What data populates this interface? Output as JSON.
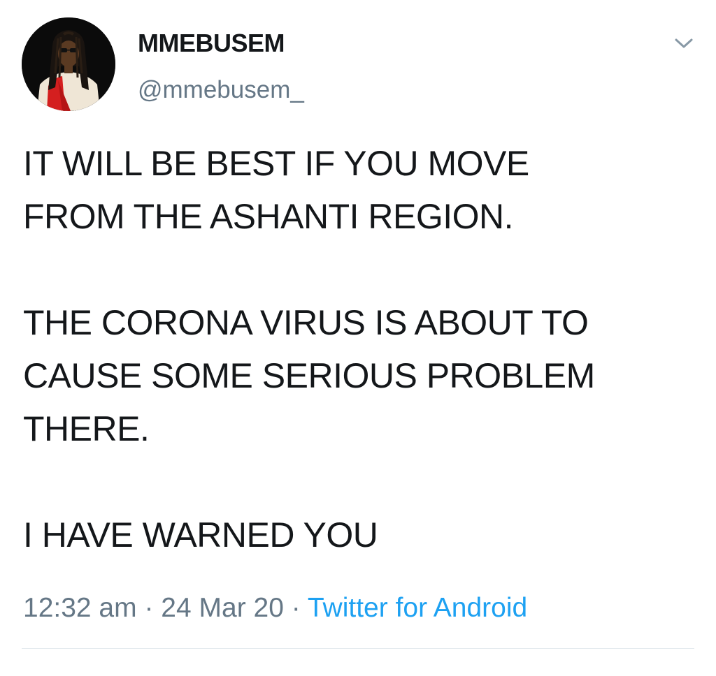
{
  "user": {
    "display_name": "MMEBUSEM",
    "handle": "@mmebusem_"
  },
  "tweet": {
    "paragraphs": [
      "IT WILL BE BEST IF YOU MOVE\nFROM THE ASHANTI REGION.",
      "THE CORONA VIRUS IS ABOUT TO\nCAUSE SOME SERIOUS PROBLEM\nTHERE.",
      "I HAVE WARNED YOU"
    ]
  },
  "meta": {
    "time": "12:32 am",
    "separator": "·",
    "date": "24 Mar 20",
    "source": "Twitter for Android"
  },
  "icons": {
    "menu": "chevron-down-icon",
    "avatar": "avatar"
  },
  "colors": {
    "text": "#14171a",
    "secondary": "#657786",
    "link": "#1da1f2",
    "divider": "#e1e8ed"
  }
}
